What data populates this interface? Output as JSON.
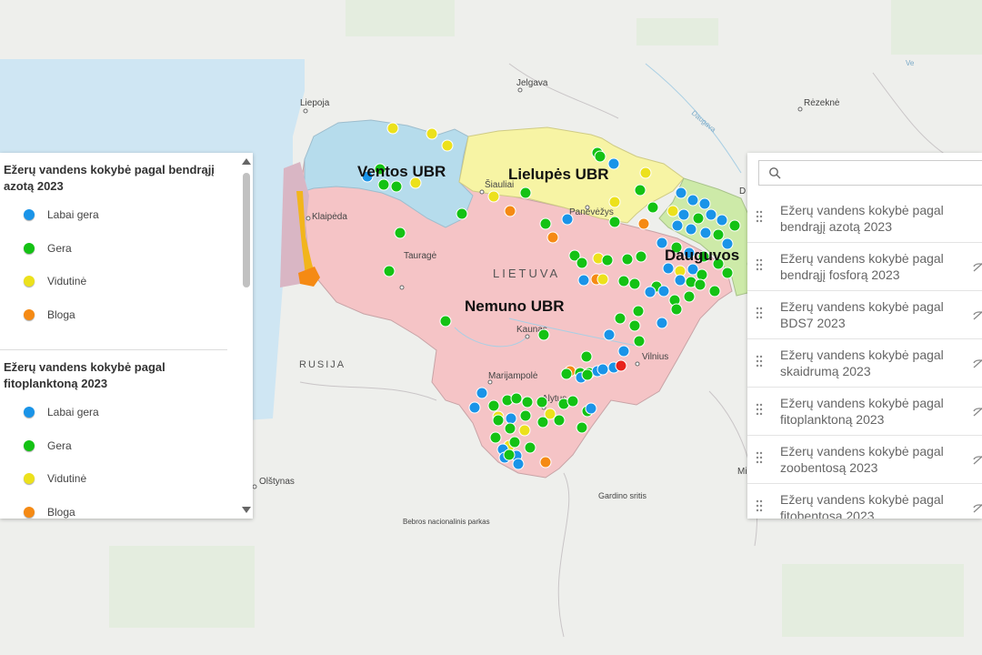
{
  "map": {
    "places": [
      "Jelgava",
      "Liepoja",
      "Rėzeknė",
      "Daugava",
      "Šiauliai",
      "Panevėžys",
      "Klaipėda",
      "Tauragė",
      "Kaunas",
      "Vilnius",
      "Marijampolė",
      "Alytus",
      "Olštynas",
      "Gardino sritis",
      "Bebros nacionalinis parkas",
      "Mi",
      "D",
      "Ve"
    ],
    "country_label": "LIETUVA",
    "russia_label": "RUSIJA",
    "basins": [
      "Ventos UBR",
      "Lielupės UBR",
      "Nemuno UBR",
      "Dauguvos"
    ],
    "colors": {
      "labai_gera": "#1a94e8",
      "gera": "#14c214",
      "vidutine": "#ece11c",
      "bloga": "#f58a14",
      "bad": "#e8221c",
      "nemuno": "#f5c4c6",
      "ventos": "#b6dcec",
      "lielupes": "#f7f4a4",
      "dauguvos": "#cdeaa8",
      "sea": "#cfe6f3"
    }
  },
  "legend": {
    "sections": [
      {
        "title": "Ežerų vandens kokybė pagal bendrąjį azotą 2023",
        "items": [
          {
            "label": "Labai gera",
            "color": "#1a94e8"
          },
          {
            "label": "Gera",
            "color": "#14c214"
          },
          {
            "label": "Vidutinė",
            "color": "#ece11c"
          },
          {
            "label": "Bloga",
            "color": "#f58a14"
          }
        ]
      },
      {
        "title": "Ežerų vandens kokybė pagal fitoplanktoną 2023",
        "items": [
          {
            "label": "Labai gera",
            "color": "#1a94e8"
          },
          {
            "label": "Gera",
            "color": "#14c214"
          },
          {
            "label": "Vidutinė",
            "color": "#ece11c"
          },
          {
            "label": "Bloga",
            "color": "#f58a14"
          }
        ]
      }
    ]
  },
  "layers": {
    "search_placeholder": "",
    "items": [
      {
        "label": "Ežerų vandens kokybė pagal bendrąjį azotą 2023"
      },
      {
        "label": "Ežerų vandens kokybė pagal bendrąjį fosforą 2023"
      },
      {
        "label": "Ežerų vandens kokybė pagal BDS7 2023"
      },
      {
        "label": "Ežerų vandens kokybė pagal skaidrumą 2023"
      },
      {
        "label": "Ežerų vandens kokybė pagal fitoplanktoną 2023"
      },
      {
        "label": "Ežerų vandens kokybė pagal zoobentosą 2023"
      },
      {
        "label": "Ežerų vandens kokybė pagal fitobentosa 2023"
      }
    ]
  }
}
